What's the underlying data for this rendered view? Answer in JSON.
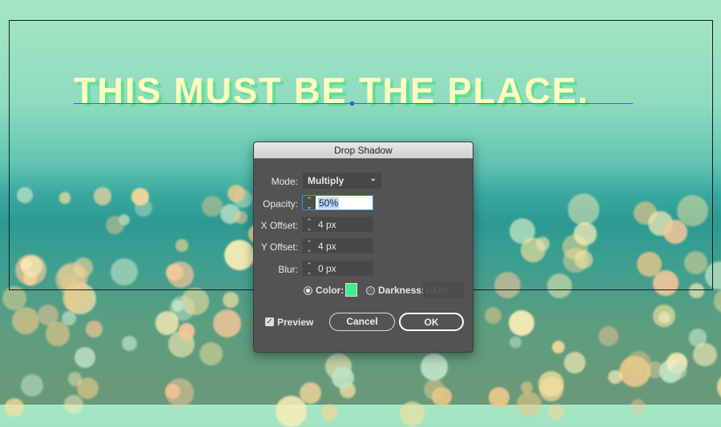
{
  "canvas": {
    "headline": "THIS MUST BE THE PLACE.",
    "text_color": "#fffbc0",
    "shadow_color": "#5fe09a"
  },
  "dialog": {
    "title": "Drop Shadow",
    "mode": {
      "label": "Mode:",
      "value": "Multiply"
    },
    "opacity": {
      "label": "Opacity:",
      "value": "50%"
    },
    "x_offset": {
      "label": "X Offset:",
      "value": "4 px"
    },
    "y_offset": {
      "label": "Y Offset:",
      "value": "4 px"
    },
    "blur": {
      "label": "Blur:",
      "value": "0 px"
    },
    "color": {
      "label": "Color:",
      "swatch": "#3ef08a",
      "selected": true
    },
    "darkness": {
      "label": "Darkness:",
      "value": "100%",
      "selected": false
    },
    "preview": {
      "label": "Preview",
      "checked": true
    },
    "cancel_label": "Cancel",
    "ok_label": "OK"
  }
}
